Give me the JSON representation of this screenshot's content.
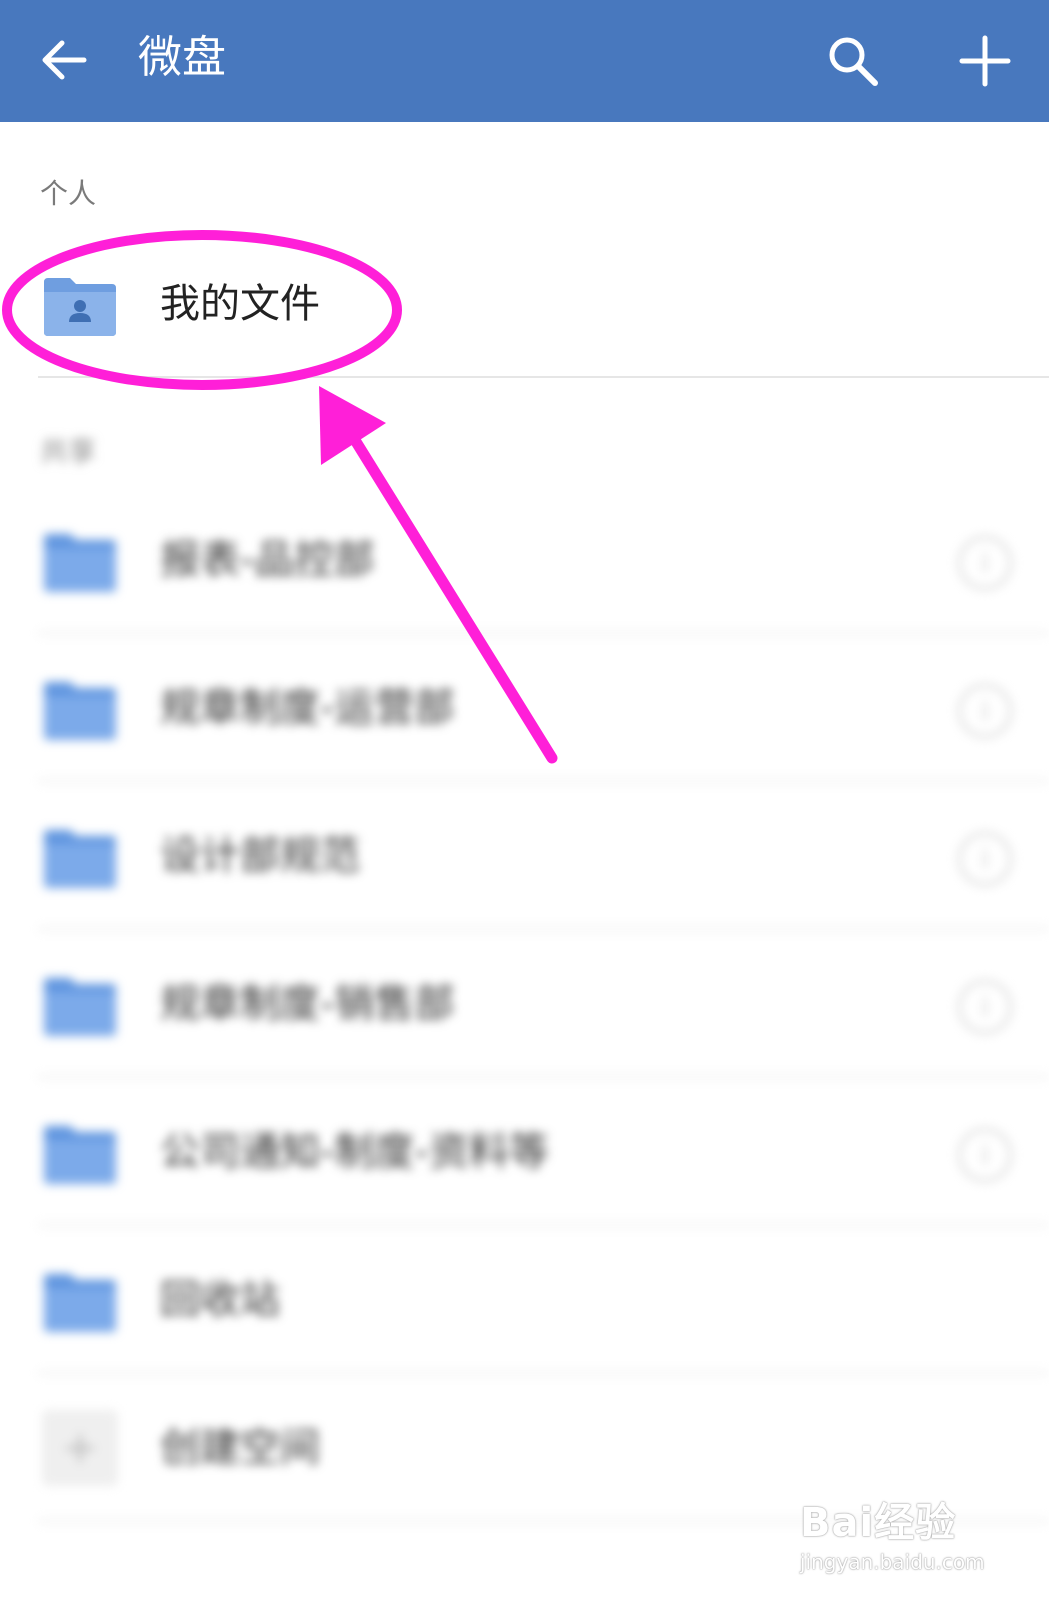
{
  "header": {
    "title": "微盘",
    "back_icon": "arrow-left-icon",
    "search_icon": "search-icon",
    "add_icon": "plus-icon",
    "bg_color": "#4878be"
  },
  "personal": {
    "label": "个人",
    "items": [
      {
        "label": "我的文件",
        "icon": "personal-folder-icon"
      }
    ]
  },
  "shared": {
    "label": "共享",
    "items": [
      {
        "label": "报表-品控部"
      },
      {
        "label": "规章制度-运营部"
      },
      {
        "label": "设计部规范"
      },
      {
        "label": "规章制度-销售部"
      },
      {
        "label": "公司通知-制度-资料等"
      },
      {
        "label": "回收站"
      },
      {
        "label": "创建空间"
      }
    ]
  },
  "annotation_color": "#ff1fd8",
  "watermark": {
    "main": "Bai经验",
    "url": "jingyan.baidu.com"
  }
}
